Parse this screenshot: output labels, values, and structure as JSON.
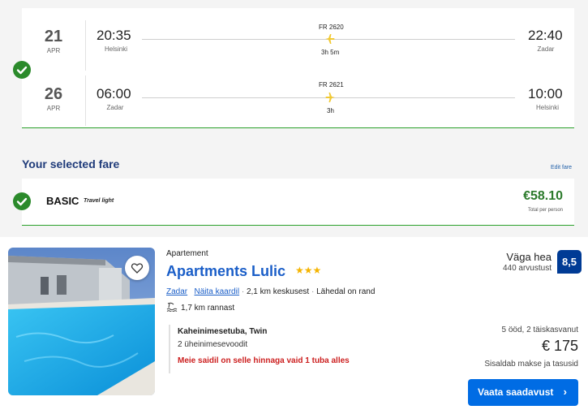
{
  "flights": [
    {
      "day": "21",
      "month": "APR",
      "dep_time": "20:35",
      "dep_city": "Helsinki",
      "flight_no": "FR 2620",
      "duration": "3h 5m",
      "arr_time": "22:40",
      "arr_city": "Zadar"
    },
    {
      "day": "26",
      "month": "APR",
      "dep_time": "06:00",
      "dep_city": "Zadar",
      "flight_no": "FR 2621",
      "duration": "3h",
      "arr_time": "10:00",
      "arr_city": "Helsinki"
    }
  ],
  "fare": {
    "section_title": "Your selected fare",
    "edit_label": "Edit fare",
    "name": "BASIC",
    "subtitle": "Travel light",
    "price": "€58.10",
    "price_note": "Total per person"
  },
  "hotel": {
    "type": "Apartement",
    "name": "Apartments Lulic",
    "stars": "★★★",
    "location_link": "Zadar",
    "map_link": "Näita kaardil",
    "distance_center": "2,1 km keskusest",
    "beach_note": "Lähedal on rand",
    "beach_distance": "1,7 km rannast",
    "room_name": "Kaheinimesetuba, Twin",
    "beds": "2 üheinimesevoodit",
    "scarcity": "Meie saidil on selle hinnaga vaid 1 tuba alles",
    "rating_word": "Väga hea",
    "reviews": "440 arvustust",
    "score": "8,5",
    "stay": "5 ööd, 2 täiskasvanut",
    "price": "€ 175",
    "taxes": "Sisaldab makse ja tasusid",
    "cta": "Vaata saadavust"
  },
  "colors": {
    "accent_green": "#2b8a2b",
    "brand_blue": "#006ce4",
    "score_blue": "#003b95",
    "title_navy": "#1f3b7a",
    "airline_yellow": "#f1c933",
    "alert_red": "#cc1f1f"
  }
}
